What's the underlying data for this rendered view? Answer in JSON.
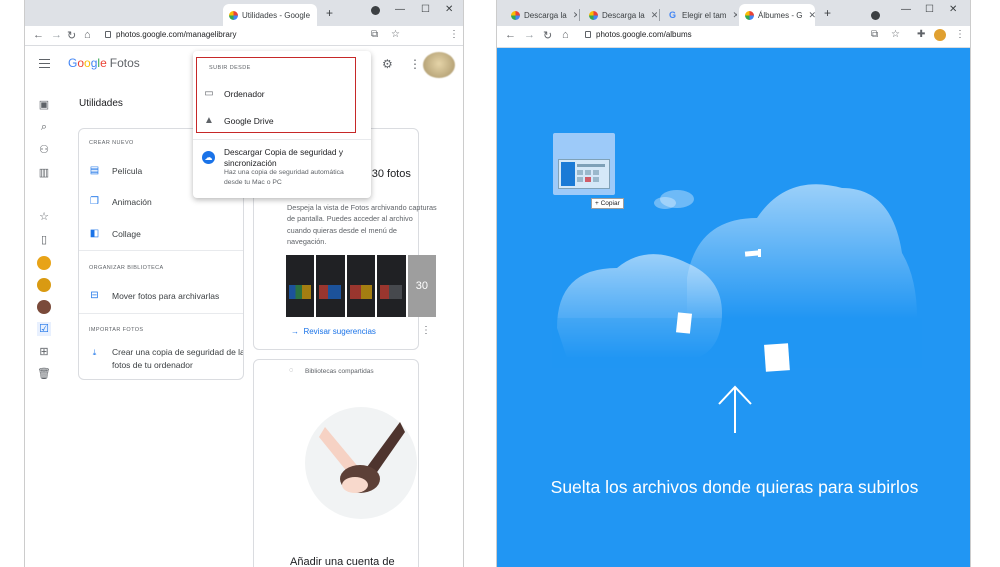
{
  "left": {
    "tabs": [
      {
        "title": "Utilidades - Google",
        "close": "✕",
        "active": true
      }
    ],
    "new_tab": "+",
    "url": "photos.google.com/managelibrary",
    "app": {
      "logo": [
        "G",
        "o",
        "o",
        "g",
        "l",
        "e"
      ],
      "logo_suffix": "Fotos",
      "page_title": "Utilidades"
    },
    "upload_menu": {
      "header": "SUBIR DESDE",
      "items": [
        "Ordenador",
        "Google Drive"
      ],
      "backup_title": "Descargar Copia de seguridad y sincronización",
      "backup_subtitle": "Haz una copia de seguridad automática desde tu Mac o PC"
    },
    "crear_nuevo": {
      "header": "CREAR NUEVO",
      "items": [
        "Película",
        "Animación",
        "Collage"
      ]
    },
    "organizar": {
      "header": "ORGANIZAR BIBLIOTECA",
      "items": [
        "Mover fotos para archivarlas"
      ]
    },
    "importar": {
      "header": "IMPORTAR FOTOS",
      "item": "Crear una copia de seguridad de las fotos de tu ordenador"
    },
    "suggestion": {
      "title_partial": "r 30 fotos",
      "description": "Despeja la vista de Fotos archivando capturas de pantalla. Puedes acceder al archivo cuando quieras desde el menú de navegación.",
      "more_count": "30",
      "link": "Revisar sugerencias"
    },
    "shared": {
      "label": "Bibliotecas compartidas",
      "title_partial": "Añadir una cuenta de"
    }
  },
  "right": {
    "tabs": [
      {
        "title": "Descarga la",
        "close": "✕",
        "active": false
      },
      {
        "title": "Descarga la",
        "close": "✕",
        "active": false
      },
      {
        "title": "Elegir el tam",
        "close": "✕",
        "active": false
      },
      {
        "title": "Álbumes - G",
        "close": "✕",
        "active": true
      }
    ],
    "new_tab": "+",
    "url": "photos.google.com/albums",
    "copy_badge": "+ Copiar",
    "drop_message": "Suelta los archivos donde quieras para subirlos"
  },
  "colors": {
    "accent": "#1a73e8",
    "drop_bg": "#2196f3",
    "highlight": "#c62828"
  }
}
